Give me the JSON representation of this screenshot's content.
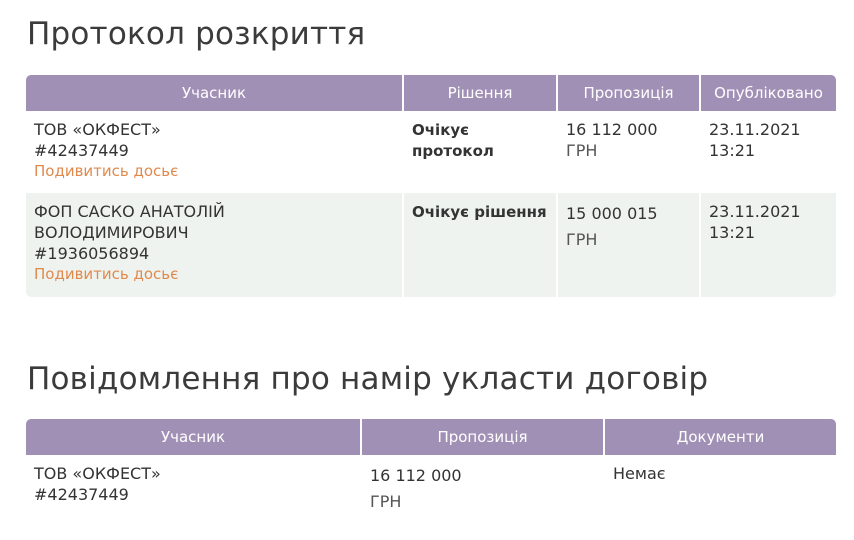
{
  "opening_protocol": {
    "title": "Протокол розкриття",
    "headers": {
      "participant": "Учасник",
      "decision": "Рішення",
      "proposal": "Пропозиція",
      "published": "Опубліковано"
    },
    "rows": [
      {
        "name": "ТОВ «ОКФЕСТ»",
        "id": "#42437449",
        "dossier_link": "Подивитись досьє",
        "decision": "Очікує протокол",
        "amount": "16 112 000",
        "currency": "ГРН",
        "date": "23.11.2021",
        "time": "13:21"
      },
      {
        "name_line1": "ФОП САСКО АНАТОЛІЙ",
        "name_line2": "ВОЛОДИМИРОВИЧ",
        "id": "#1936056894",
        "dossier_link": "Подивитись досьє",
        "decision": "Очікує рішення",
        "amount": "15 000 015",
        "currency": "ГРН",
        "date": "23.11.2021",
        "time": "13:21"
      }
    ]
  },
  "contract_intent": {
    "title": "Повідомлення про намір укласти договір",
    "headers": {
      "participant": "Учасник",
      "proposal": "Пропозиція",
      "documents": "Документи"
    },
    "rows": [
      {
        "name": "ТОВ «ОКФЕСТ»",
        "id": "#42437449",
        "amount": "16 112 000",
        "currency": "ГРН",
        "documents": "Немає"
      }
    ]
  },
  "colors": {
    "header_bg": "#a190b5",
    "alt_row_bg": "#eef3ef",
    "link": "#e0894c"
  }
}
